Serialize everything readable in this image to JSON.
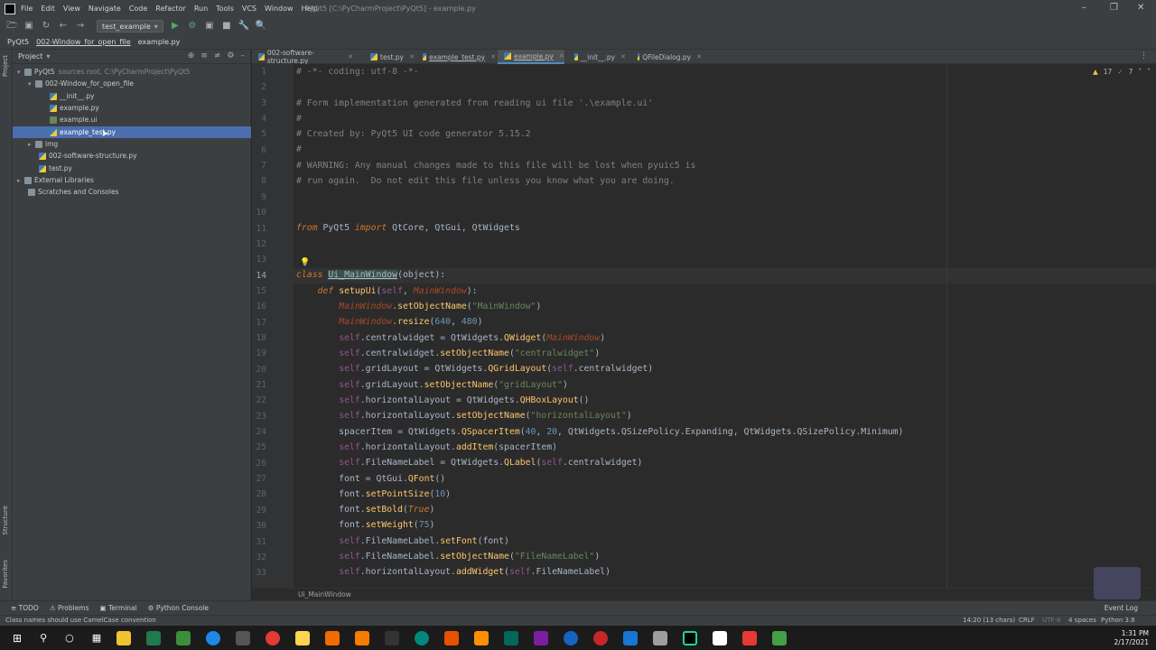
{
  "window_title": "PyQt5 [C:\\PyCharmProject\\PyQt5] - example.py",
  "menu": [
    "File",
    "Edit",
    "View",
    "Navigate",
    "Code",
    "Refactor",
    "Run",
    "Tools",
    "VCS",
    "Window",
    "Help"
  ],
  "run_config": "test_example",
  "breadcrumb": [
    "PyQt5",
    "002-Window_for_open_file",
    "example.py"
  ],
  "project_panel": {
    "title": "Project",
    "root": "PyQt5",
    "root_hint": "sources root, C:\\PyCharmProject\\PyQt5",
    "items": [
      {
        "label": "002-Window_for_open_file"
      },
      {
        "label": "__init__.py"
      },
      {
        "label": "example.py"
      },
      {
        "label": "example.ui"
      },
      {
        "label": "example_test.py"
      },
      {
        "label": "img"
      },
      {
        "label": "002-software-structure.py"
      },
      {
        "label": "test.py"
      },
      {
        "label": "External Libraries"
      },
      {
        "label": "Scratches and Consoles"
      }
    ]
  },
  "left_strip": [
    "Project",
    "Structure",
    "Favorites"
  ],
  "tabs": [
    "002-software-structure.py",
    "test.py",
    "example_test.py",
    "example.py",
    "__init__.py",
    "QFileDialog.py"
  ],
  "active_tab": "example.py",
  "inspection": {
    "warnings": "17",
    "ok": "7"
  },
  "line_numbers": [
    "1",
    "2",
    "3",
    "4",
    "5",
    "6",
    "7",
    "8",
    "9",
    "10",
    "11",
    "12",
    "13",
    "14",
    "15",
    "16",
    "17",
    "18",
    "19",
    "20",
    "21",
    "22",
    "23",
    "24",
    "25",
    "26",
    "27",
    "28",
    "29",
    "30",
    "31",
    "32",
    "33"
  ],
  "editor_breadcrumb": "Ui_MainWindow",
  "bottom_tools": [
    "TODO",
    "Problems",
    "Terminal",
    "Python Console"
  ],
  "status": {
    "message": "Class names should use CamelCase convention",
    "position": "14:20 (13 chars)",
    "line_sep": "CRLF",
    "encoding": "UTF-8",
    "indent": "4 spaces",
    "interpreter": "Python 3.8",
    "event_log": "Event Log"
  },
  "clock": {
    "time": "1:31 PM",
    "date": "2/17/2021"
  },
  "colors": {
    "accent": "#4b6eaf",
    "keyword": "#cc7832",
    "string": "#6a8759",
    "comment": "#808080",
    "number": "#6897bb"
  }
}
